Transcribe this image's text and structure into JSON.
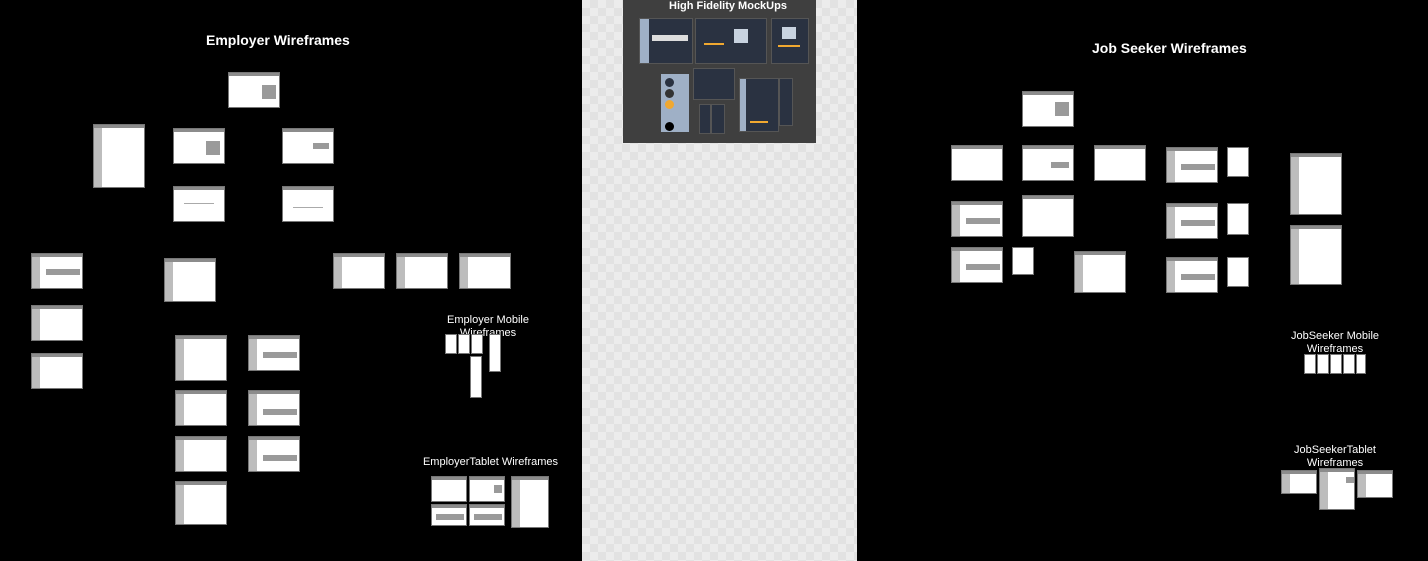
{
  "sections": {
    "employer": {
      "title": "Employer Wireframes",
      "mobile_label": "Employer Mobile Wireframes",
      "tablet_label": "EmployerTablet Wireframes"
    },
    "mockups": {
      "title": "High Fidelity MockUps"
    },
    "jobseeker": {
      "title": "Job Seeker Wireframes",
      "mobile_label": "JobSeeker Mobile Wireframes",
      "tablet_label": "JobSeekerTablet Wireframes"
    }
  },
  "colors": {
    "canvas": "#000000",
    "frame": "#ffffff",
    "mockup_bg": "#3f3f3f",
    "accent": "#f0a830"
  }
}
